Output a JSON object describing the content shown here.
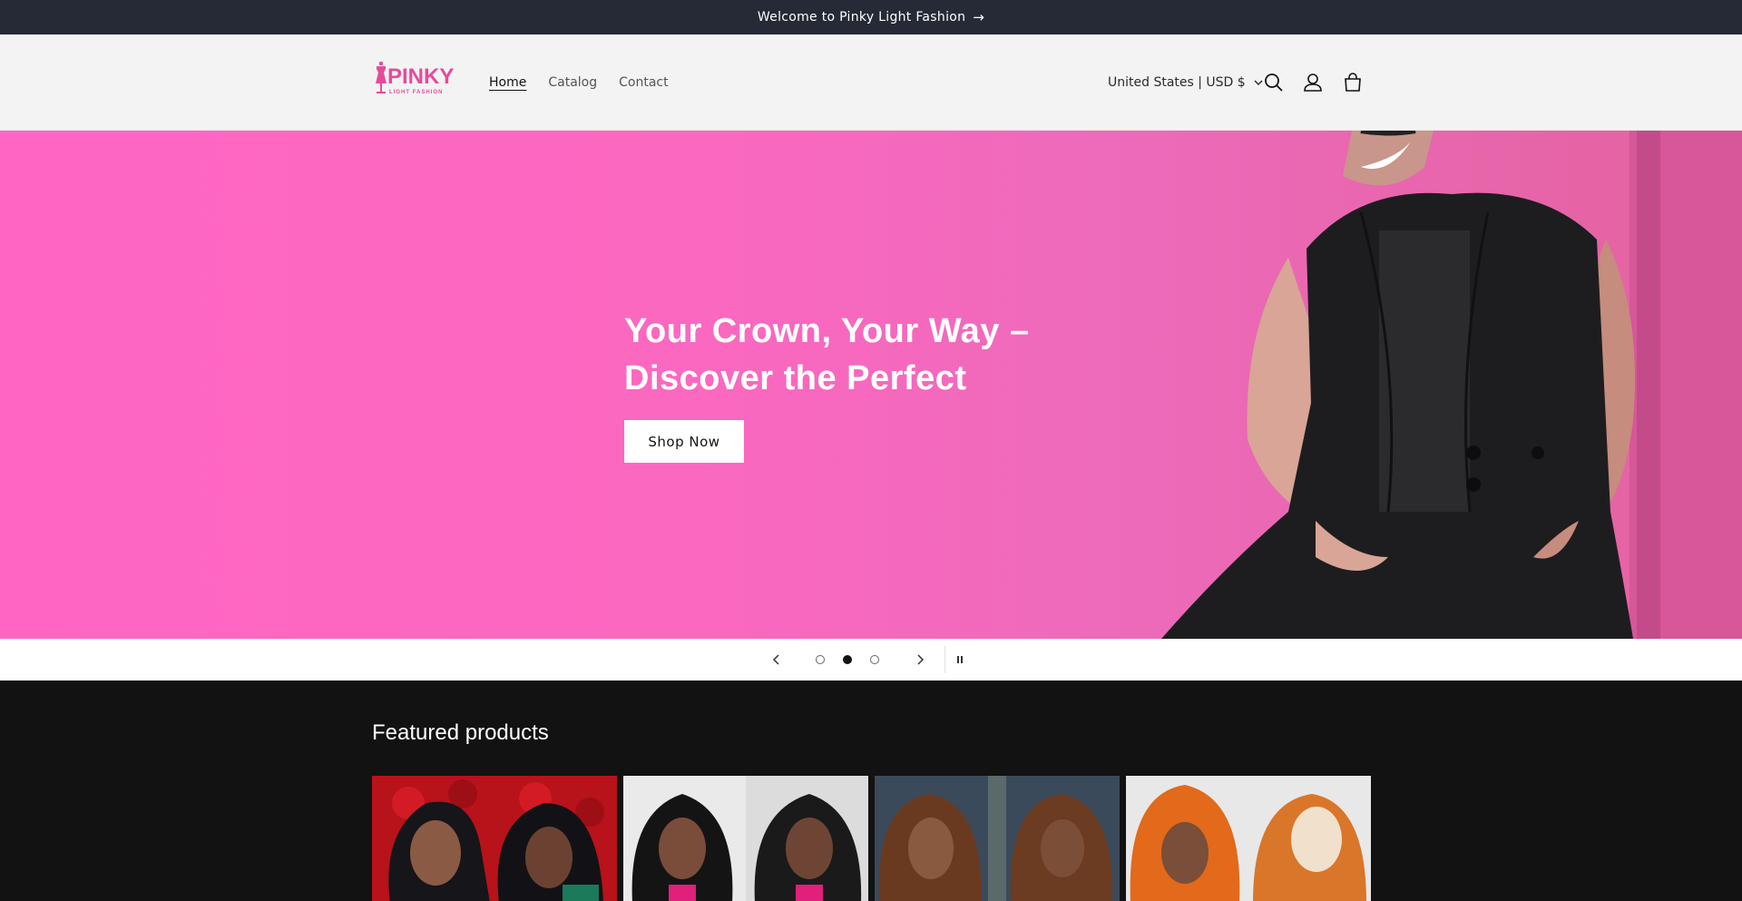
{
  "announcement": {
    "text": "Welcome to Pinky Light Fashion",
    "arrow_icon": "arrow-right-icon"
  },
  "header": {
    "logo_text": "PINKY",
    "logo_subtext": "LIGHT FASHION",
    "nav": [
      {
        "label": "Home",
        "active": true
      },
      {
        "label": "Catalog",
        "active": false
      },
      {
        "label": "Contact",
        "active": false
      }
    ],
    "locale": "United States | USD $",
    "icons": [
      "search-icon",
      "account-icon",
      "cart-icon"
    ]
  },
  "hero": {
    "title": "Your Crown, Your Way – Discover the Perfect",
    "button": "Shop Now",
    "slides_total": 3,
    "current_slide": 2
  },
  "featured": {
    "title": "Featured products"
  },
  "colors": {
    "announcement_bg": "#252a36",
    "header_bg": "#f3f3f3",
    "hero_pink": "#ff66c4",
    "logo_pink": "#e84a9b",
    "featured_bg": "#121212"
  }
}
